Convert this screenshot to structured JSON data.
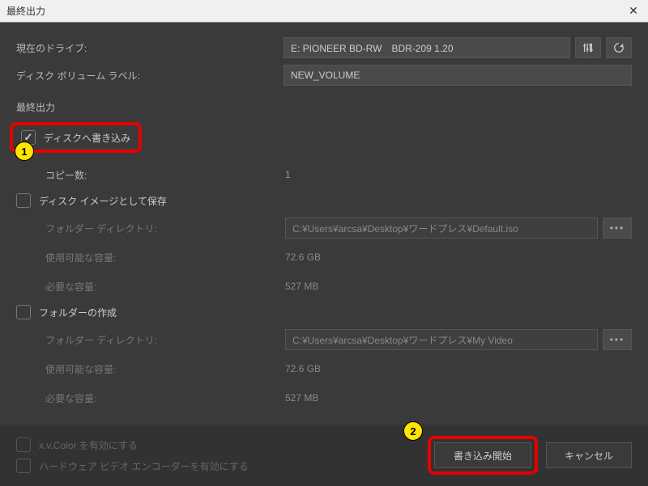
{
  "titlebar": {
    "title": "最終出力"
  },
  "drive": {
    "label": "現在のドライブ:",
    "value": "E: PIONEER BD-RW　BDR-209 1.20"
  },
  "volume": {
    "label": "ディスク ボリューム ラベル:",
    "value": "NEW_VOLUME"
  },
  "section_title": "最終出力",
  "burn_disc": {
    "label": "ディスクへ書き込み",
    "checked": true
  },
  "copies": {
    "label": "コピー数:",
    "value": "1"
  },
  "save_image": {
    "label": "ディスク イメージとして保存",
    "folder_label": "フォルダー ディレクトリ:",
    "folder_value": "C:¥Users¥arcsa¥Desktop¥ワードプレス¥Default.iso",
    "available_label": "使用可能な容量:",
    "available_value": "72.6 GB",
    "required_label": "必要な容量:",
    "required_value": "527 MB"
  },
  "create_folder": {
    "label": "フォルダーの作成",
    "folder_label": "フォルダー ディレクトリ:",
    "folder_value": "C:¥Users¥arcsa¥Desktop¥ワードプレス¥My Video",
    "available_label": "使用可能な容量:",
    "available_value": "72.6 GB",
    "required_label": "必要な容量:",
    "required_value": "527 MB"
  },
  "footer": {
    "xvcolor_label": "x.v.Color を有効にする",
    "hwencoder_label": "ハードウェア ビデオ エンコーダーを有効にする",
    "start_label": "書き込み開始",
    "cancel_label": "キャンセル"
  },
  "badges": {
    "one": "1",
    "two": "2"
  }
}
